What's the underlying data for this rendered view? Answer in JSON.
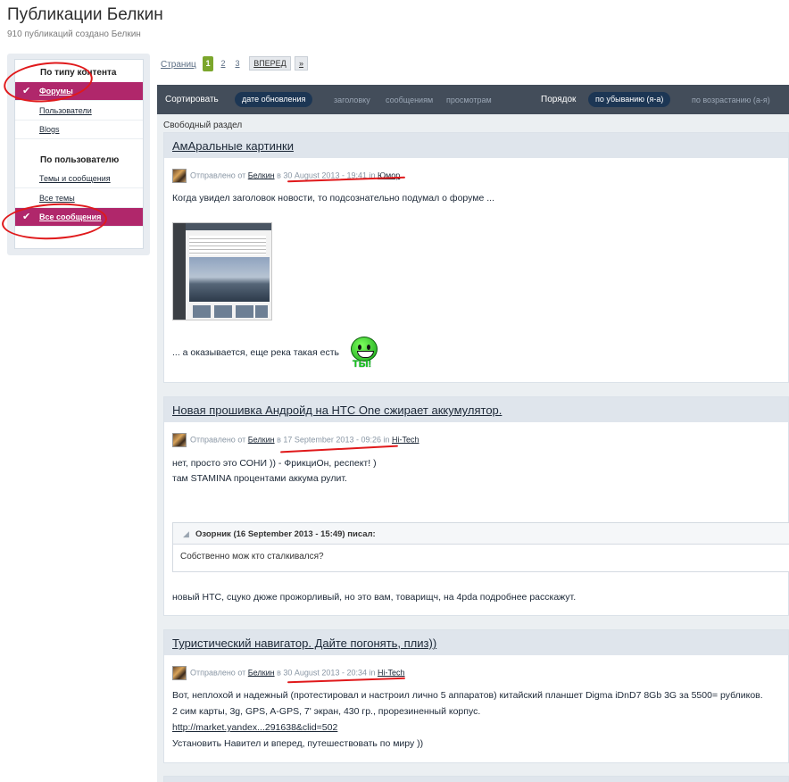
{
  "header": {
    "title": "Публикации Белкин",
    "subtitle": "910 публикаций создано Белкин"
  },
  "sidebar": {
    "by_content_heading": "По типу контента",
    "by_user_heading": "По пользователю",
    "items": [
      {
        "label": "Форумы",
        "active": true
      },
      {
        "label": "Пользователи",
        "active": false
      },
      {
        "label": "Blogs",
        "active": false
      },
      {
        "label": "Темы и сообщения",
        "active": false
      },
      {
        "label": "Все темы",
        "active": false
      },
      {
        "label": "Все сообщения",
        "active": true
      }
    ],
    "check_icon": "✔"
  },
  "pagination": {
    "label": "Страниц",
    "pages": [
      "1",
      "2",
      "3"
    ],
    "current": "1",
    "next_label": "ВПЕРЕД",
    "last_label": "»"
  },
  "sortbar": {
    "sort_label": "Сортировать",
    "sort_options": [
      "дате обновления",
      "заголовку",
      "сообщениям",
      "просмотрам"
    ],
    "sort_active": "дате обновления",
    "order_label": "Порядок",
    "order_options": [
      "по убыванию (я-а)",
      "по возрастанию (а-я)"
    ],
    "order_active": "по убыванию (я-а)"
  },
  "section_label": "Свободный раздел",
  "posts": [
    {
      "title": "АмАральные картинки",
      "meta_prefix": "Отправлено от",
      "author": "Белкин",
      "meta_in": "в",
      "date": "30 August 2013 - 19:41",
      "meta_in2": "in",
      "category": "Юмор",
      "lines": [
        "Когда увидел заголовок новости, то подсознательно подумал о форуме ..."
      ],
      "after_image": "... а оказывается, еще река такая есть",
      "smiley_text": "ТЫ!"
    },
    {
      "title": "Новая прошивка Андройд на HTC One сжирает аккумулятор.",
      "meta_prefix": "Отправлено от",
      "author": "Белкин",
      "meta_in": "в",
      "date": "17 September 2013 - 09:26",
      "meta_in2": "in",
      "category": "Hi-Tech",
      "lines": [
        "нет, просто это СОНИ )) - ФрикциОн, респект! )",
        "там STAMINA процентами аккума рулит."
      ],
      "quote_author": "Озорник (16 September 2013 - 15:49) писал:",
      "quote_text": "Собственно мож кто сталкивался?",
      "after_quote": "новый HTC, сцуко дюже прожорливый, но это вам, товарищч, на 4pda подробнее расскажут."
    },
    {
      "title": "Туристический навигатор. Дайте погонять, плиз))",
      "meta_prefix": "Отправлено от",
      "author": "Белкин",
      "meta_in": "в",
      "date": "30 August 2013 - 20:34",
      "meta_in2": "in",
      "category": "Hi-Tech",
      "lines": [
        "Вот, неплохой и надежный (протестировал и настроил лично 5 аппаратов) китайский планшет Digma iDnD7 8Gb 3G за 5500= рубликов.",
        "2 сим карты, 3g, GPS, A-GPS, 7' экран, 430 гр., прорезиненный корпус."
      ],
      "link": "http://market.yandex...291638&clid=502",
      "last_line": "Установить Навител и вперед, путешествовать по миру ))"
    }
  ],
  "colors": {
    "accent": "#b0276b",
    "sortbar": "#434d5a",
    "pill": "#1c3654",
    "page_current": "#7ba62c",
    "annotation": "#e0191b"
  }
}
